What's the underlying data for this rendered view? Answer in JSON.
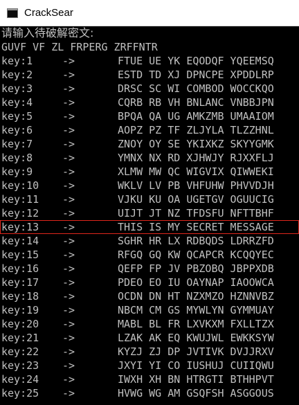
{
  "window": {
    "title": "CrackSear"
  },
  "console": {
    "prompt": "请输入待破解密文:",
    "ciphertext": "GUVF VF ZL FRPERG ZRFFNTR",
    "arrow": "->",
    "highlight_key": 13,
    "highlight_color": "#e0261b",
    "rows": [
      {
        "key": "key:1",
        "text": "FTUE UE YK EQODQF YQEEMSQ"
      },
      {
        "key": "key:2",
        "text": "ESTD TD XJ DPNCPE XPDDLRP"
      },
      {
        "key": "key:3",
        "text": "DRSC SC WI COMBOD WOCCKQO"
      },
      {
        "key": "key:4",
        "text": "CQRB RB VH BNLANC VNBBJPN"
      },
      {
        "key": "key:5",
        "text": "BPQA QA UG AMKZMB UMAAIOM"
      },
      {
        "key": "key:6",
        "text": "AOPZ PZ TF ZLJYLA TLZZHNL"
      },
      {
        "key": "key:7",
        "text": "ZNOY OY SE YKIXKZ SKYYGMK"
      },
      {
        "key": "key:8",
        "text": "YMNX NX RD XJHWJY RJXXFLJ"
      },
      {
        "key": "key:9",
        "text": "XLMW MW QC WIGVIX QIWWEKI"
      },
      {
        "key": "key:10",
        "text": "WKLV LV PB VHFUHW PHVVDJH"
      },
      {
        "key": "key:11",
        "text": "VJKU KU OA UGETGV OGUUCIG"
      },
      {
        "key": "key:12",
        "text": "UIJT JT NZ TFDSFU NFTTBHF"
      },
      {
        "key": "key:13",
        "text": "THIS IS MY SECRET MESSAGE"
      },
      {
        "key": "key:14",
        "text": "SGHR HR LX RDBQDS LDRRZFD"
      },
      {
        "key": "key:15",
        "text": "RFGQ GQ KW QCAPCR KCQQYEC"
      },
      {
        "key": "key:16",
        "text": "QEFP FP JV PBZOBQ JBPPXDB"
      },
      {
        "key": "key:17",
        "text": "PDEO EO IU OAYNAP IAOOWCA"
      },
      {
        "key": "key:18",
        "text": "OCDN DN HT NZXMZO HZNNVBZ"
      },
      {
        "key": "key:19",
        "text": "NBCM CM GS MYWLYN GYMMUAY"
      },
      {
        "key": "key:20",
        "text": "MABL BL FR LXVKXM FXLLTZX"
      },
      {
        "key": "key:21",
        "text": "LZAK AK EQ KWUJWL EWKKSYW"
      },
      {
        "key": "key:22",
        "text": "KYZJ ZJ DP JVTIVK DVJJRXV"
      },
      {
        "key": "key:23",
        "text": "JXYI YI CO IUSHUJ CUIIQWU"
      },
      {
        "key": "key:24",
        "text": "IWXH XH BN HTRGTI BTHHPVT"
      },
      {
        "key": "key:25",
        "text": "HVWG WG AM GSQFSH ASGGOUS"
      }
    ]
  }
}
